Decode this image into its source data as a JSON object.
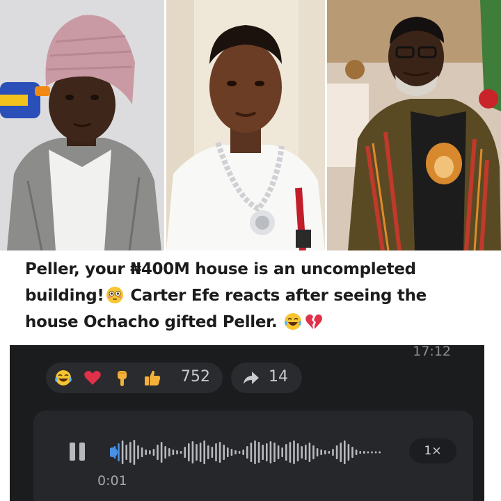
{
  "headline": {
    "line1": "Peller, your ₦400M house is an uncompleted",
    "line2_a": "building!",
    "line2_b": "Carter Efe reacts after seeing the",
    "line3": "house Ochacho gifted Peller.",
    "emojis": [
      "flushed-face",
      "tears-of-joy-face",
      "broken-heart"
    ]
  },
  "collage": {
    "photos": [
      "man-in-pink-beanie-with-toy-gun",
      "young-man-with-chain-necklace",
      "man-in-glasses-with-lion-shirt"
    ]
  },
  "chat": {
    "timestamp": "17:12",
    "reactions": [
      "tears-of-joy",
      "red-heart",
      "pointing-down",
      "thumbs-up"
    ],
    "reaction_count": "752",
    "forward_count": "14",
    "voice_message": {
      "duration": "0:01",
      "speed": "1×",
      "state": "playing",
      "progress": 0.04
    }
  },
  "colors": {
    "chat_bg": "#1b1c1e",
    "bubble_bg": "#26272a",
    "wave_played": "#4a90e2",
    "wave_unplayed": "#b8b9bc"
  }
}
